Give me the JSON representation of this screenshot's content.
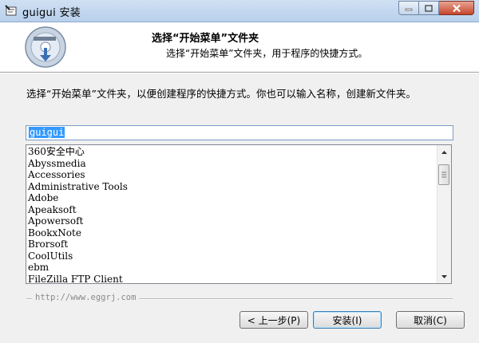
{
  "window": {
    "title": "guigui  安装",
    "icons": {
      "app": "installer-icon",
      "min": "minimize-icon",
      "max": "maximize-icon",
      "close": "close-icon"
    }
  },
  "header": {
    "heading": "选择“开始菜单”文件夹",
    "subtitle": "选择“开始菜单”文件夹，用于程序的快捷方式。",
    "logo_icon": "installer-disc-icon"
  },
  "body": {
    "description": "选择“开始菜单”文件夹，以便创建程序的快捷方式。你也可以输入名称，创建新文件夹。",
    "folder_value": "guigui",
    "folders": [
      "360安全中心",
      "Abyssmedia",
      "Accessories",
      "Administrative Tools",
      "Adobe",
      "Apeaksoft",
      "Apowersoft",
      "BookxNote",
      "Brorsoft",
      "CoolUtils",
      "ebm",
      "FileZilla FTP Client"
    ]
  },
  "footer": {
    "branding": "http://www.eggrj.com",
    "back_label": "< 上一步(P)",
    "install_label": "安装(I)",
    "cancel_label": "取消(C)"
  }
}
